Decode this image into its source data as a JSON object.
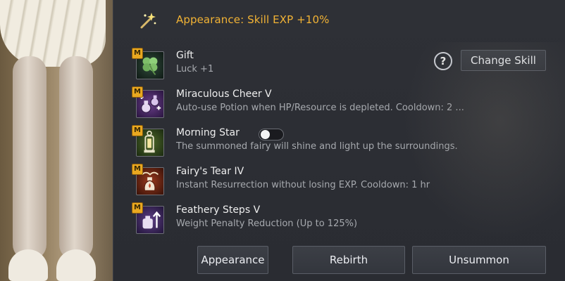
{
  "header": {
    "title": "Appearance: Skill EXP +10%",
    "icon": "magic-wand-icon"
  },
  "help_label": "?",
  "change_skill_label": "Change Skill",
  "badge_label": "M",
  "skills": [
    {
      "name": "Gift",
      "desc": "Luck +1",
      "icon": "clover-icon"
    },
    {
      "name": "Miraculous Cheer V",
      "desc": "Auto-use Potion when HP/Resource is depleted. Cooldown: 2 ...",
      "icon": "potions-icon"
    },
    {
      "name": "Morning Star",
      "desc": "The summoned fairy will shine and light up the surroundings.",
      "icon": "lantern-icon",
      "toggle_on": false
    },
    {
      "name": "Fairy's Tear IV",
      "desc": "Instant Resurrection without losing EXP. Cooldown: 1 hr",
      "icon": "tear-vial-icon"
    },
    {
      "name": "Feathery Steps V",
      "desc": "Weight Penalty Reduction (Up to 125%)",
      "icon": "weight-up-icon"
    }
  ],
  "buttons": {
    "appearance": "Appearance",
    "rebirth": "Rebirth",
    "unsummon": "Unsummon"
  },
  "colors": {
    "accent": "#f2b335",
    "badge": "#e9a820",
    "panel": "#2b2d33"
  }
}
